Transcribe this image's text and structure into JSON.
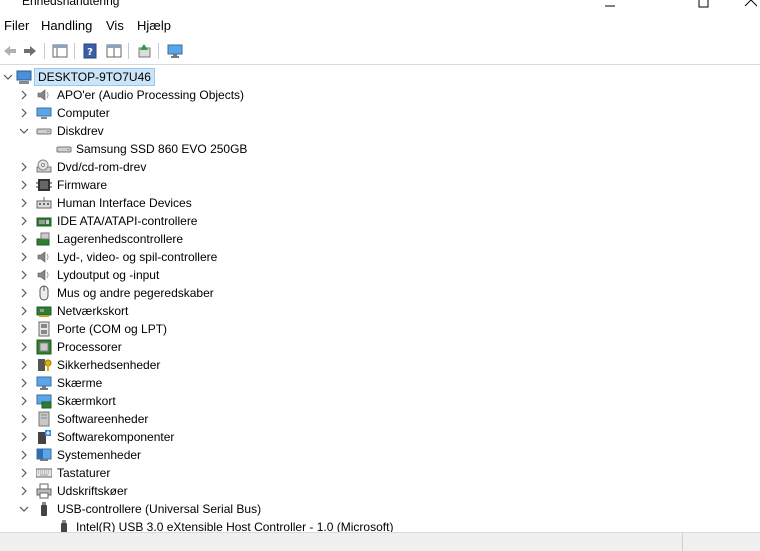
{
  "window": {
    "title": "Enhedshåndtering",
    "controls": [
      "minimize-icon",
      "maximize-icon",
      "close-icon"
    ]
  },
  "menu": {
    "items": [
      "Filer",
      "Handling",
      "Vis",
      "Hjælp"
    ]
  },
  "toolbar": {
    "buttons": [
      "back-icon",
      "forward-icon",
      "properties-pane-icon",
      "help-icon",
      "view-icon",
      "update-driver-icon",
      "monitor-scan-icon"
    ]
  },
  "tree": {
    "root": "DESKTOP-9TO7U46",
    "items": [
      {
        "label": "APO'er (Audio Processing Objects)",
        "icon": "speaker-icon",
        "state": "collapsed"
      },
      {
        "label": "Computer",
        "icon": "computer-icon",
        "state": "collapsed"
      },
      {
        "label": "Diskdrev",
        "icon": "disk-drive-icon",
        "state": "expanded"
      },
      {
        "label": "Samsung SSD 860 EVO 250GB",
        "icon": "disk-drive-icon",
        "state": "child"
      },
      {
        "label": "Dvd/cd-rom-drev",
        "icon": "dvd-drive-icon",
        "state": "collapsed"
      },
      {
        "label": "Firmware",
        "icon": "firmware-icon",
        "state": "collapsed"
      },
      {
        "label": "Human Interface Devices",
        "icon": "hid-icon",
        "state": "collapsed"
      },
      {
        "label": "IDE ATA/ATAPI-controllere",
        "icon": "ide-controller-icon",
        "state": "collapsed"
      },
      {
        "label": "Lagerenhedscontrollere",
        "icon": "storage-controller-icon",
        "state": "collapsed"
      },
      {
        "label": "Lyd-, video- og spil-controllere",
        "icon": "speaker-icon",
        "state": "collapsed"
      },
      {
        "label": "Lydoutput og -input",
        "icon": "speaker-icon",
        "state": "collapsed"
      },
      {
        "label": "Mus og andre pegeredskaber",
        "icon": "mouse-icon",
        "state": "collapsed"
      },
      {
        "label": "Netværkskort",
        "icon": "network-adapter-icon",
        "state": "collapsed"
      },
      {
        "label": "Porte (COM og LPT)",
        "icon": "port-icon",
        "state": "collapsed"
      },
      {
        "label": "Processorer",
        "icon": "processor-icon",
        "state": "collapsed"
      },
      {
        "label": "Sikkerhedsenheder",
        "icon": "security-device-icon",
        "state": "collapsed"
      },
      {
        "label": "Skærme",
        "icon": "monitor-icon",
        "state": "collapsed"
      },
      {
        "label": "Skærmkort",
        "icon": "display-adapter-icon",
        "state": "collapsed"
      },
      {
        "label": "Softwareenheder",
        "icon": "software-device-icon",
        "state": "collapsed"
      },
      {
        "label": "Softwarekomponenter",
        "icon": "software-component-icon",
        "state": "collapsed"
      },
      {
        "label": "Systemenheder",
        "icon": "system-device-icon",
        "state": "collapsed"
      },
      {
        "label": "Tastaturer",
        "icon": "keyboard-icon",
        "state": "collapsed"
      },
      {
        "label": "Udskriftskøer",
        "icon": "printer-icon",
        "state": "collapsed"
      },
      {
        "label": "USB-controllere (Universal Serial Bus)",
        "icon": "usb-icon",
        "state": "expanded"
      },
      {
        "label": "Intel(R) USB 3.0 eXtensible Host Controller - 1.0 (Microsoft)",
        "icon": "usb-icon",
        "state": "child"
      }
    ]
  },
  "colors": {
    "selection_bg": "#cce4f7",
    "selection_border": "#99c9ef",
    "chevron": "#555555"
  }
}
